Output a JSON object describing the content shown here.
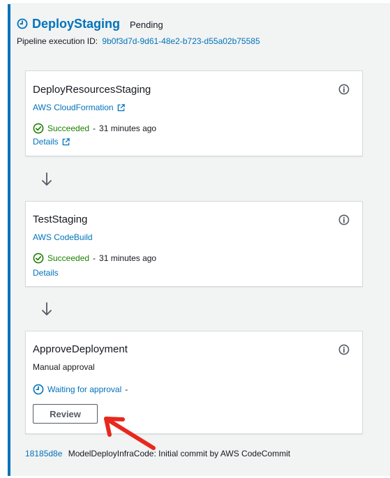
{
  "stage": {
    "name": "DeployStaging",
    "status": "Pending",
    "execution_label": "Pipeline execution ID:",
    "execution_id": "9b0f3d7d-9d61-48e2-b723-d55a02b75585",
    "icon": "clock-icon"
  },
  "actions": [
    {
      "name": "DeployResourcesStaging",
      "provider": "AWS CloudFormation",
      "status": "Succeeded",
      "separator": "-",
      "time": "31 minutes ago",
      "details": "Details"
    },
    {
      "name": "TestStaging",
      "provider": "AWS CodeBuild",
      "status": "Succeeded",
      "separator": "-",
      "time": "31 minutes ago",
      "details": "Details"
    },
    {
      "name": "ApproveDeployment",
      "provider": "Manual approval",
      "status": "Waiting for approval",
      "separator": "-",
      "button": "Review"
    }
  ],
  "commit": {
    "id": "18185d8e",
    "message": "ModelDeployInfraCode: Initial commit by AWS CodeCommit"
  },
  "colors": {
    "link": "#0073bb",
    "success": "#1d8102",
    "accent_border": "#0073bb",
    "annotation": "#e8281d"
  }
}
